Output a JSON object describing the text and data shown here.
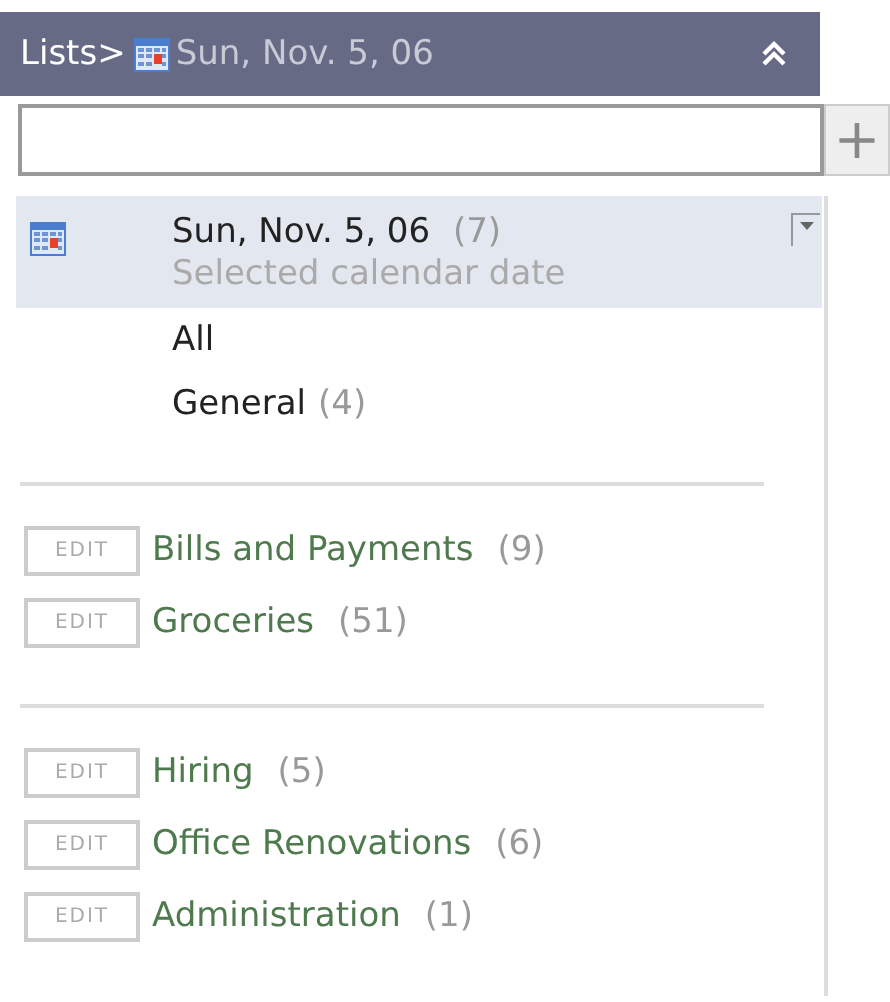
{
  "header": {
    "breadcrumb": "Lists>",
    "title": "Sun, Nov. 5, 06"
  },
  "add_button": "+",
  "top_items": [
    {
      "kind": "date",
      "label": "Sun, Nov. 5, 06",
      "count": "(7)",
      "subtitle": "Selected calendar date",
      "selected": true
    },
    {
      "kind": "plain",
      "label": "All",
      "selected": false
    },
    {
      "kind": "plain",
      "label": "General",
      "count": "(4)",
      "selected": false
    }
  ],
  "groups": [
    [
      {
        "edit": "EDIT",
        "label": "Bills and Payments",
        "count": "(9)"
      },
      {
        "edit": "EDIT",
        "label": "Groceries",
        "count": "(51)"
      }
    ],
    [
      {
        "edit": "EDIT",
        "label": "Hiring",
        "count": "(5)"
      },
      {
        "edit": "EDIT",
        "label": "Office Renovations",
        "count": "(6)"
      },
      {
        "edit": "EDIT",
        "label": "Administration",
        "count": "(1)"
      }
    ]
  ]
}
